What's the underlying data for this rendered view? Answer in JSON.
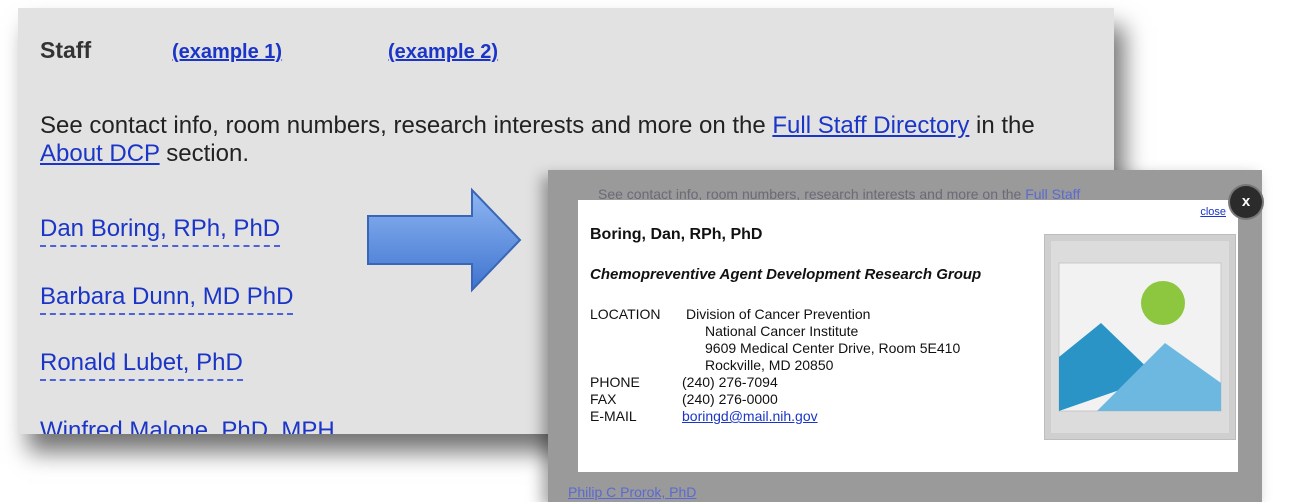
{
  "staff_page": {
    "title": "Staff",
    "example1": "(example 1)",
    "example2": "(example 2)",
    "intro_prefix": "See contact info, room numbers, research interests and more on the ",
    "intro_link1": "Full Staff Directory",
    "intro_middle": " in the ",
    "intro_link2": "About DCP",
    "intro_suffix": " section.",
    "staff": [
      "Dan Boring, RPh, PhD",
      "Barbara Dunn, MD PhD",
      "Ronald Lubet, PhD",
      "Winfred Malone, PhD, MPH"
    ]
  },
  "popup": {
    "background_text": "See contact info, room numbers, research interests and more on the ",
    "background_link": "Full Staff",
    "background_bottom": "Philip C Prorok, PhD",
    "close_link": "close",
    "close_button": "x",
    "name": "Boring, Dan, RPh, PhD",
    "group": "Chemopreventive Agent Development Research Group",
    "location_label": "LOCATION",
    "location_lines": [
      "Division of Cancer Prevention",
      "National Cancer Institute",
      "9609 Medical Center Drive, Room 5E410",
      "Rockville, MD 20850"
    ],
    "phone_label": "PHONE",
    "phone": "(240) 276-7094",
    "fax_label": "FAX",
    "fax": "(240) 276-0000",
    "email_label": "E-MAIL",
    "email": "boringd@mail.nih.gov",
    "photo_icon": "image-placeholder-icon"
  },
  "colors": {
    "link": "#1a35c7",
    "panel_bg": "#e2e2e2",
    "arrow": "#5b8ee0",
    "overlay": "#9a9a9a"
  }
}
